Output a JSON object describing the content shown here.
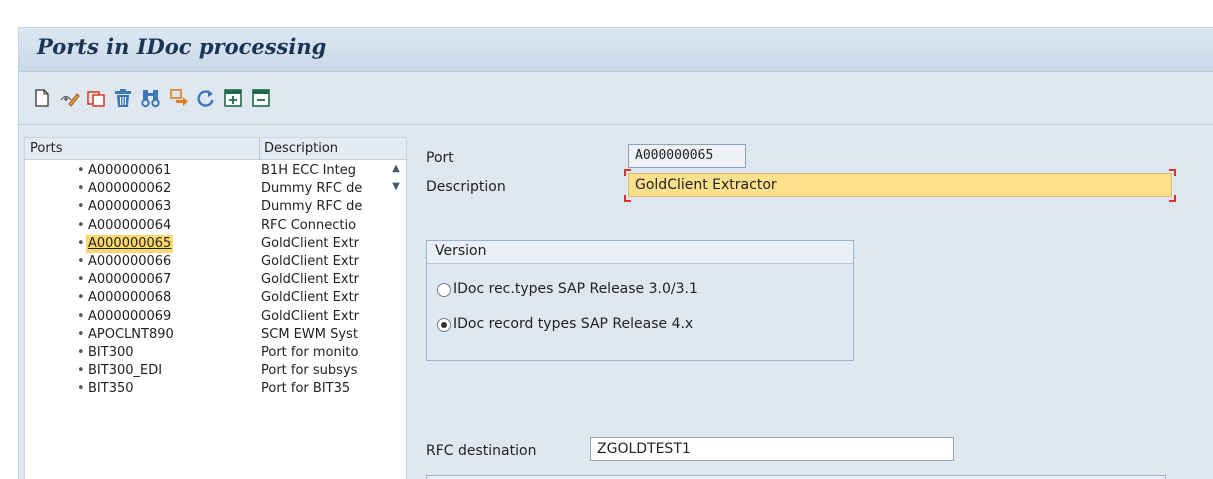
{
  "window": {
    "title": "Ports in IDoc processing"
  },
  "toolbar": {
    "buttons": [
      {
        "name": "new-entry-icon",
        "glyph": "🗋"
      },
      {
        "name": "display-change-icon",
        "glyph": "✎"
      },
      {
        "name": "copy-icon",
        "glyph": "⧉"
      },
      {
        "name": "delete-icon",
        "glyph": "🗑"
      },
      {
        "name": "find-icon",
        "glyph": "⌕"
      },
      {
        "name": "transfer-icon",
        "glyph": "⇨"
      },
      {
        "name": "refresh-icon",
        "glyph": "⟳"
      },
      {
        "name": "expand-icon",
        "glyph": "⊞"
      },
      {
        "name": "collapse-icon",
        "glyph": "⊟"
      }
    ]
  },
  "tree": {
    "columns": {
      "ports": "Ports",
      "description": "Description"
    },
    "rows": [
      {
        "port": "A000000061",
        "desc": "B1H ECC Integ"
      },
      {
        "port": "A000000062",
        "desc": "Dummy RFC de"
      },
      {
        "port": "A000000063",
        "desc": "Dummy RFC de"
      },
      {
        "port": "A000000064",
        "desc": "RFC Connectio"
      },
      {
        "port": "A000000065",
        "desc": "GoldClient Extr"
      },
      {
        "port": "A000000066",
        "desc": "GoldClient Extr"
      },
      {
        "port": "A000000067",
        "desc": "GoldClient Extr"
      },
      {
        "port": "A000000068",
        "desc": "GoldClient Extr"
      },
      {
        "port": "A000000069",
        "desc": "GoldClient Extr"
      },
      {
        "port": "APOCLNT890",
        "desc": "SCM EWM Syst"
      },
      {
        "port": "BIT300",
        "desc": "Port for monito"
      },
      {
        "port": "BIT300_EDI",
        "desc": "Port for subsys"
      },
      {
        "port": "BIT350",
        "desc": "Port for BIT35"
      }
    ],
    "selected_index": 4
  },
  "detail": {
    "port_label": "Port",
    "port_value": "A000000065",
    "description_label": "Description",
    "description_value": "GoldClient Extractor",
    "version_group": "Version",
    "radio_30": "IDoc rec.types SAP Release 3.0/3.1",
    "radio_4x": "IDoc record types SAP Release 4.x",
    "selected_version": "4.x",
    "rfc_label": "RFC destination",
    "rfc_value": "ZGOLDTEST1"
  },
  "colors": {
    "selection": "#fdd96d",
    "focus_field": "#fbe08e",
    "panel_bg": "#dfe8f1",
    "title": "#1a3553"
  }
}
